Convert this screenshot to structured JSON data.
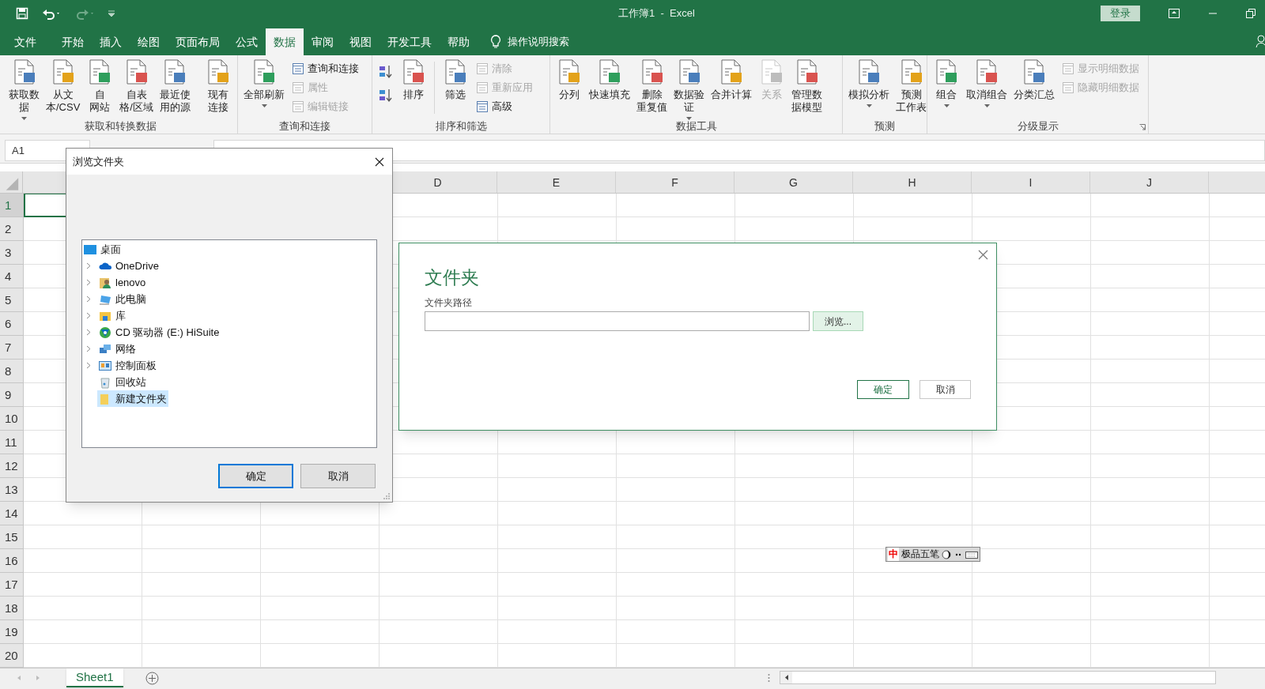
{
  "title_bar": {
    "title": "工作簿1  -  Excel",
    "sign_in": "登录"
  },
  "tabs": [
    {
      "label": "文件",
      "selected": false
    },
    {
      "label": "开始",
      "selected": false
    },
    {
      "label": "插入",
      "selected": false
    },
    {
      "label": "绘图",
      "selected": false
    },
    {
      "label": "页面布局",
      "selected": false
    },
    {
      "label": "公式",
      "selected": false
    },
    {
      "label": "数据",
      "selected": true
    },
    {
      "label": "审阅",
      "selected": false
    },
    {
      "label": "视图",
      "selected": false
    },
    {
      "label": "开发工具",
      "selected": false
    },
    {
      "label": "帮助",
      "selected": false
    }
  ],
  "tell_me": "操作说明搜索",
  "ribbon_groups": [
    {
      "title": "获取和转换数据",
      "buttons": [
        {
          "kind": "large",
          "lines": [
            "获取数",
            "据"
          ],
          "dropdown": true,
          "disabled": false
        },
        {
          "kind": "large",
          "lines": [
            "从文",
            "本/CSV"
          ],
          "dropdown": false,
          "disabled": false
        },
        {
          "kind": "large",
          "lines": [
            "自",
            "网站"
          ],
          "dropdown": false,
          "disabled": false
        },
        {
          "kind": "large",
          "lines": [
            "自表",
            "格/区域"
          ],
          "dropdown": false,
          "disabled": false
        },
        {
          "kind": "large",
          "lines": [
            "最近使",
            "用的源"
          ],
          "dropdown": false,
          "disabled": false
        },
        {
          "kind": "separator"
        },
        {
          "kind": "large",
          "lines": [
            "现有",
            "连接"
          ],
          "dropdown": false,
          "disabled": false
        }
      ]
    },
    {
      "title": "查询和连接",
      "buttons": [
        {
          "kind": "large",
          "lines": [
            "全部刷新"
          ],
          "dropdown": true,
          "disabled": false
        },
        {
          "kind": "small",
          "lines": [
            "查询和连接"
          ],
          "disabled": false
        },
        {
          "kind": "small",
          "lines": [
            "属性"
          ],
          "disabled": true
        },
        {
          "kind": "small",
          "lines": [
            "编辑链接"
          ],
          "disabled": true
        }
      ]
    },
    {
      "title": "排序和筛选",
      "buttons": [
        {
          "kind": "sort"
        },
        {
          "kind": "large",
          "lines": [
            "排序"
          ],
          "dropdown": false,
          "disabled": false
        },
        {
          "kind": "separator"
        },
        {
          "kind": "large",
          "lines": [
            "筛选"
          ],
          "dropdown": false,
          "disabled": false
        },
        {
          "kind": "small",
          "lines": [
            "清除"
          ],
          "disabled": true
        },
        {
          "kind": "small",
          "lines": [
            "重新应用"
          ],
          "disabled": true
        },
        {
          "kind": "small",
          "lines": [
            "高级"
          ],
          "disabled": false
        }
      ]
    },
    {
      "title": "数据工具",
      "buttons": [
        {
          "kind": "large",
          "lines": [
            "分列"
          ],
          "dropdown": false,
          "disabled": false
        },
        {
          "kind": "large",
          "lines": [
            "快速填充"
          ],
          "dropdown": false,
          "disabled": false
        },
        {
          "kind": "large",
          "lines": [
            "删除",
            "重复值"
          ],
          "dropdown": false,
          "disabled": false
        },
        {
          "kind": "large",
          "lines": [
            "数据验",
            "证"
          ],
          "dropdown": true,
          "disabled": false
        },
        {
          "kind": "large",
          "lines": [
            "合并计算"
          ],
          "dropdown": false,
          "disabled": false
        },
        {
          "kind": "large",
          "lines": [
            "关系"
          ],
          "dropdown": false,
          "disabled": true
        },
        {
          "kind": "large",
          "lines": [
            "管理数",
            "据模型"
          ],
          "dropdown": false,
          "disabled": false
        }
      ]
    },
    {
      "title": "预测",
      "buttons": [
        {
          "kind": "large",
          "lines": [
            "模拟分析"
          ],
          "dropdown": true,
          "disabled": false
        },
        {
          "kind": "large",
          "lines": [
            "预测",
            "工作表"
          ],
          "dropdown": false,
          "disabled": false
        }
      ]
    },
    {
      "title": "分级显示",
      "launcher": true,
      "buttons": [
        {
          "kind": "large",
          "lines": [
            "组合"
          ],
          "dropdown": true,
          "disabled": false
        },
        {
          "kind": "large",
          "lines": [
            "取消组合"
          ],
          "dropdown": true,
          "disabled": false
        },
        {
          "kind": "large",
          "lines": [
            "分类汇总"
          ],
          "dropdown": false,
          "disabled": false
        },
        {
          "kind": "small",
          "lines": [
            "显示明细数据"
          ],
          "disabled": true
        },
        {
          "kind": "small",
          "lines": [
            "隐藏明细数据"
          ],
          "disabled": true
        }
      ]
    }
  ],
  "name_box": "A1",
  "column_headers": [
    "D",
    "E",
    "F",
    "G",
    "H",
    "I",
    "J"
  ],
  "rows": [
    {
      "label": "1",
      "selected": true
    },
    {
      "label": "2",
      "selected": false
    },
    {
      "label": "3",
      "selected": false
    },
    {
      "label": "4",
      "selected": false
    },
    {
      "label": "5",
      "selected": false
    },
    {
      "label": "6",
      "selected": false
    },
    {
      "label": "7",
      "selected": false
    },
    {
      "label": "8",
      "selected": false
    },
    {
      "label": "9",
      "selected": false
    },
    {
      "label": "10",
      "selected": false
    },
    {
      "label": "11",
      "selected": false
    },
    {
      "label": "12",
      "selected": false
    },
    {
      "label": "13",
      "selected": false
    },
    {
      "label": "14",
      "selected": false
    },
    {
      "label": "15",
      "selected": false
    },
    {
      "label": "16",
      "selected": false
    },
    {
      "label": "17",
      "selected": false
    },
    {
      "label": "18",
      "selected": false
    },
    {
      "label": "19",
      "selected": false
    },
    {
      "label": "20",
      "selected": false
    }
  ],
  "sheet_tabs": [
    {
      "label": "Sheet1",
      "selected": true
    }
  ],
  "browse_dialog": {
    "title": "浏览文件夹",
    "tree": {
      "label": "桌面",
      "children": [
        {
          "label": "OneDrive",
          "expandable": true,
          "selected": false
        },
        {
          "label": "lenovo",
          "expandable": true,
          "selected": false
        },
        {
          "label": "此电脑",
          "expandable": true,
          "selected": false
        },
        {
          "label": "库",
          "expandable": true,
          "selected": false
        },
        {
          "label": "CD 驱动器 (E:) HiSuite",
          "expandable": true,
          "selected": false
        },
        {
          "label": "网络",
          "expandable": true,
          "selected": false
        },
        {
          "label": "控制面板",
          "expandable": true,
          "selected": false
        },
        {
          "label": "回收站",
          "expandable": false,
          "selected": false
        },
        {
          "label": "新建文件夹",
          "expandable": false,
          "selected": true
        }
      ]
    },
    "ok": "确定",
    "cancel": "取消"
  },
  "folder_dialog": {
    "heading": "文件夹",
    "field_label": "文件夹路径",
    "browse": "浏览...",
    "ok": "确定",
    "cancel": "取消"
  },
  "ime_bar": {
    "mode": "中",
    "name": "极品五笔"
  }
}
